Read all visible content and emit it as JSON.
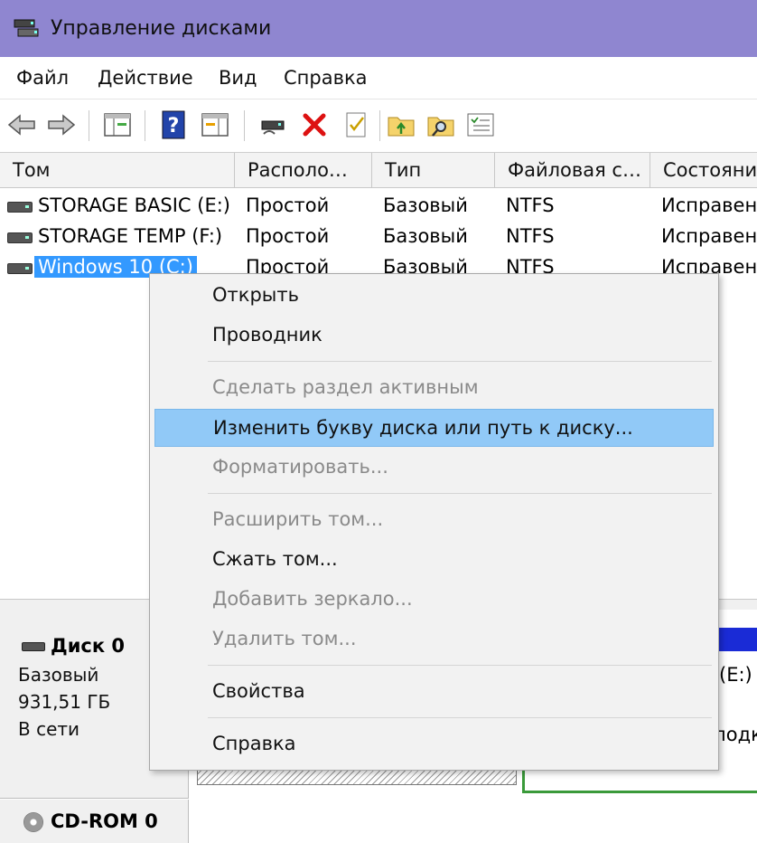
{
  "window": {
    "title": "Управление дисками",
    "title_color": "#8f86d0"
  },
  "menubar": {
    "items": [
      "Файл",
      "Действие",
      "Вид",
      "Справка"
    ]
  },
  "toolbar": {
    "icons": [
      "back-arrow-icon",
      "forward-arrow-icon",
      "console-tree-icon",
      "help-icon",
      "action-pane-icon",
      "connect-drive-icon",
      "delete-icon",
      "properties-check-icon",
      "folder-up-icon",
      "folder-search-icon",
      "settings-list-icon"
    ]
  },
  "volume_list": {
    "columns": [
      "Том",
      "Располо…",
      "Тип",
      "Файловая с…",
      "Состояни"
    ],
    "rows": [
      {
        "name": "STORAGE BASIC (E:)",
        "layout": "Простой",
        "type": "Базовый",
        "fs": "NTFS",
        "status": "Исправен"
      },
      {
        "name": "STORAGE TEMP (F:)",
        "layout": "Простой",
        "type": "Базовый",
        "fs": "NTFS",
        "status": "Исправен"
      },
      {
        "name": "Windows 10 (C:)",
        "layout": "Простой",
        "type": "Базовый",
        "fs": "NTFS",
        "status": "Исправен"
      }
    ]
  },
  "context_menu": {
    "items": [
      {
        "label": "Открыть",
        "disabled": false
      },
      {
        "label": "Проводник",
        "disabled": false
      },
      {
        "label": "Сделать раздел активным",
        "disabled": true
      },
      {
        "label": "Изменить букву диска или путь к диску...",
        "disabled": false,
        "highlighted": true
      },
      {
        "label": "Форматировать...",
        "disabled": true
      },
      {
        "label": "Расширить том...",
        "disabled": true
      },
      {
        "label": "Сжать том...",
        "disabled": false
      },
      {
        "label": "Добавить зеркало...",
        "disabled": true
      },
      {
        "label": "Удалить том...",
        "disabled": true
      },
      {
        "label": "Свойства",
        "disabled": false
      },
      {
        "label": "Справка",
        "disabled": false
      }
    ]
  },
  "disk_pane": {
    "disk0": {
      "title": "Диск 0",
      "type": "Базовый",
      "size": "931,51 ГБ",
      "state": "В сети"
    },
    "cdrom": {
      "title": "CD-ROM 0"
    },
    "partition_label": "(E:)",
    "partition_fragment": "подк"
  }
}
